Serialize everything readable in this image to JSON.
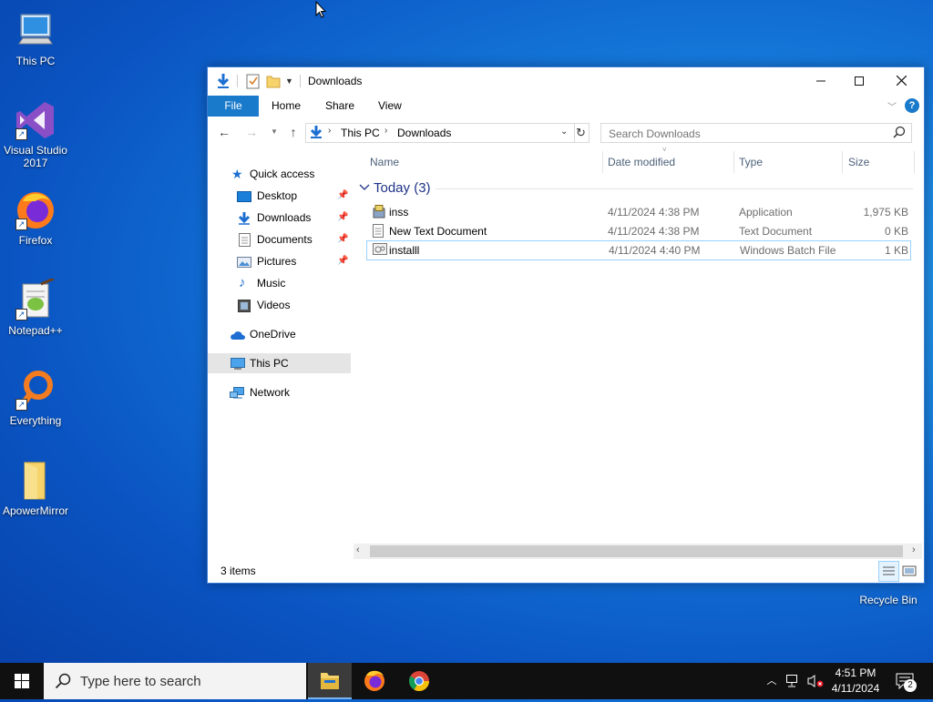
{
  "desktop": {
    "icons": [
      {
        "label": "This PC"
      },
      {
        "label": "Visual Studio 2017"
      },
      {
        "label": "Firefox"
      },
      {
        "label": "Notepad++"
      },
      {
        "label": "Everything"
      },
      {
        "label": "ApowerMirror"
      },
      {
        "label": "Recycle Bin"
      }
    ]
  },
  "window": {
    "title": "Downloads",
    "ribbon_tabs": [
      "File",
      "Home",
      "Share",
      "View"
    ],
    "breadcrumb": [
      "This PC",
      "Downloads"
    ],
    "search_placeholder": "Search Downloads",
    "nav": {
      "quick_access": "Quick access",
      "items": [
        "Desktop",
        "Downloads",
        "Documents",
        "Pictures",
        "Music",
        "Videos"
      ],
      "onedrive": "OneDrive",
      "this_pc": "This PC",
      "network": "Network"
    },
    "columns": [
      "Name",
      "Date modified",
      "Type",
      "Size"
    ],
    "group": "Today (3)",
    "files": [
      {
        "name": "inss",
        "date": "4/11/2024 4:38 PM",
        "type": "Application",
        "size": "1,975 KB"
      },
      {
        "name": "New Text Document",
        "date": "4/11/2024 4:38 PM",
        "type": "Text Document",
        "size": "0 KB"
      },
      {
        "name": "installl",
        "date": "4/11/2024 4:40 PM",
        "type": "Windows Batch File",
        "size": "1 KB"
      }
    ],
    "status": "3 items"
  },
  "taskbar": {
    "search_placeholder": "Type here to search",
    "time": "4:51 PM",
    "date": "4/11/2024",
    "notification_count": "2"
  },
  "colors": {
    "accent": "#1979ca",
    "selection_border": "#99d1ff",
    "group_header": "#1e3287",
    "column_header": "#4c607a"
  }
}
